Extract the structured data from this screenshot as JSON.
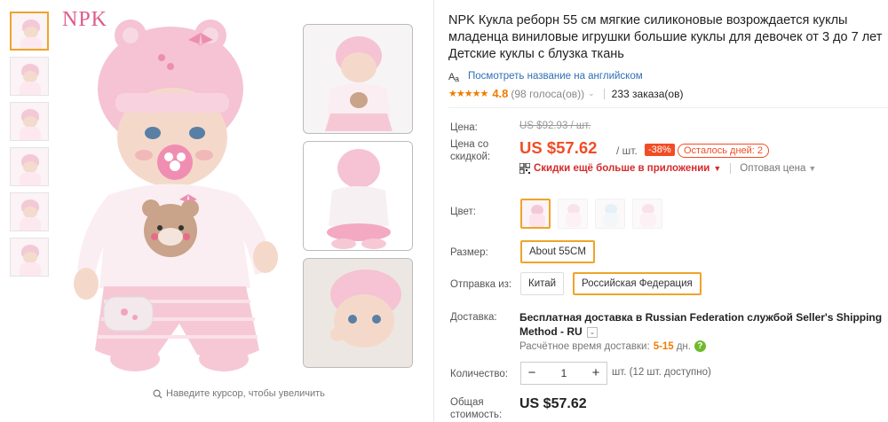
{
  "gallery": {
    "thumbnail_count": 6,
    "zoom_hint": "Наведите курсор, чтобы увеличить",
    "brand_logo": "NPK"
  },
  "product": {
    "title": "NPK Кукла реборн 55 см мягкие силиконовые возрождается куклы младенца виниловые игрушки большие куклы для девочек от 3 до 7 лет Детские куклы с блузка ткань",
    "translate_link": "Посмотреть название на английском",
    "rating": {
      "stars": "★★★★★",
      "score": "4.8",
      "votes": "(98 голоса(ов))",
      "orders": "233 заказа(ов)"
    }
  },
  "price": {
    "label_old": "Цена:",
    "old_value": "US $92.93 / шт.",
    "label_new": "Цена со скидкой:",
    "new_value": "US $57.62",
    "per_unit": "/ шт.",
    "discount": "-38%",
    "days_left": "Осталось дней: 2",
    "app_deal": "Скидки ещё больше в приложении",
    "wholesale": "Оптовая цена"
  },
  "options": {
    "color_label": "Цвет:",
    "size_label": "Размер:",
    "size_value": "About 55CM",
    "ship_from_label": "Отправка из:",
    "ship_from_options": [
      "Китай",
      "Российская Федерация"
    ]
  },
  "delivery": {
    "label": "Доставка:",
    "title": "Бесплатная доставка в Russian Federation службой Seller's Shipping Method - RU",
    "dropdown_glyph": "⌄",
    "estimate_label": "Расчётное время доставки:",
    "estimate_value": "5-15",
    "estimate_unit": "дн.",
    "help_glyph": "?"
  },
  "quantity": {
    "label": "Количество:",
    "value": "1",
    "minus": "−",
    "plus": "+",
    "note": "шт. (12 шт. доступно)"
  },
  "total": {
    "label": "Общая стоимость:",
    "value": "US $57.62"
  },
  "colors": {
    "accent": "#f0a329",
    "price_red": "#f24c24",
    "star_orange": "#f07c00",
    "link_blue": "#2f6fb5"
  }
}
